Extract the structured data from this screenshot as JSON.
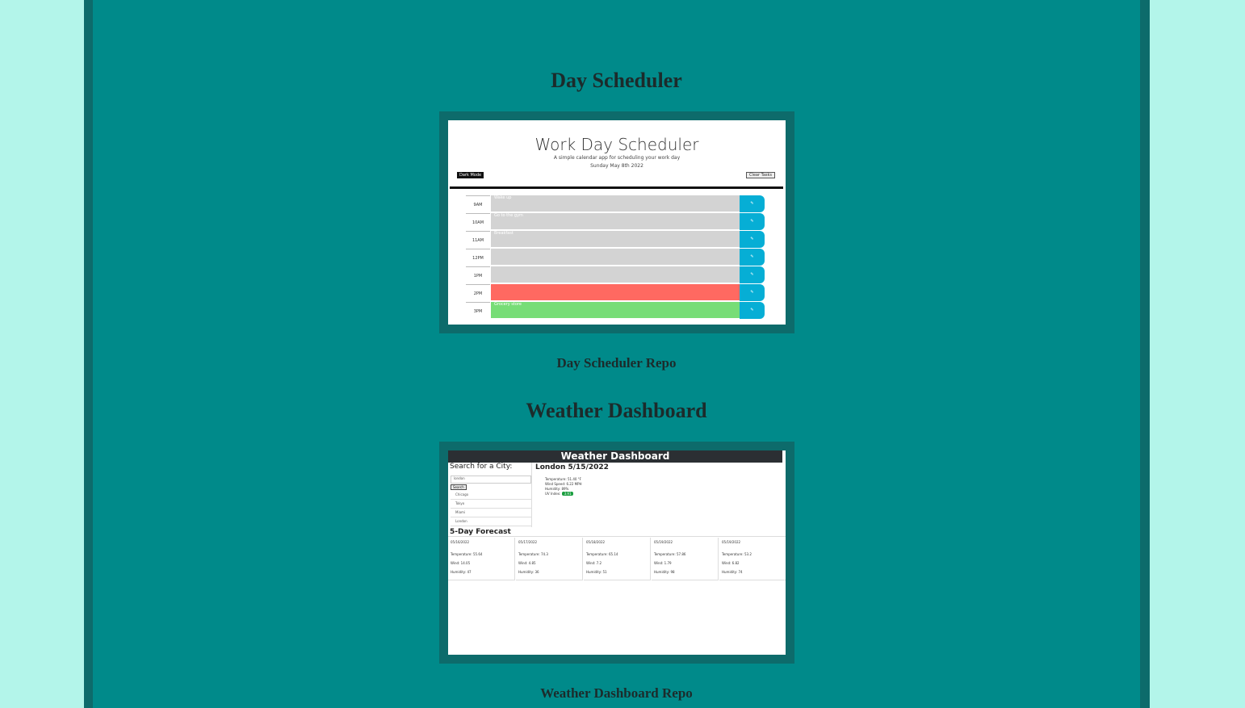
{
  "sections": [
    {
      "title": "Day Scheduler",
      "repo_label": "Day Scheduler Repo",
      "preview": {
        "app_title": "Work Day Scheduler",
        "subtitle": "A simple calendar app for scheduling your work day",
        "date": "Sunday May 8th 2022",
        "dark_mode_label": "Dark Mode",
        "clear_label": "Clear Tasks",
        "save_label": "✎",
        "rows": [
          {
            "hour": "9AM",
            "text": "Wake up",
            "color": "#d3d3d3"
          },
          {
            "hour": "10AM",
            "text": "Go to the gym",
            "color": "#d3d3d3"
          },
          {
            "hour": "11AM",
            "text": "Breakfast",
            "color": "#d3d3d3"
          },
          {
            "hour": "12PM",
            "text": "",
            "color": "#d3d3d3"
          },
          {
            "hour": "1PM",
            "text": "",
            "color": "#d3d3d3"
          },
          {
            "hour": "2PM",
            "text": "",
            "color": "#ff6961"
          },
          {
            "hour": "3PM",
            "text": "Grocery store",
            "color": "#77dd77"
          }
        ]
      }
    },
    {
      "title": "Weather Dashboard",
      "repo_label": "Weather Dashboard Repo",
      "preview": {
        "header": "Weather Dashboard",
        "search_label": "Search for a City:",
        "input_value": "london",
        "search_button": "Search",
        "cities": [
          "Chicago",
          "Tokyo",
          "Miami",
          "London"
        ],
        "current_title": "London 5/15/2022",
        "current": [
          "Temperature: 51.40 °F",
          "Wind Speed: 6.22 MPH",
          "Humidity: 89%"
        ],
        "uv_label": "UV Index:",
        "uv_value": "3.91",
        "forecast_title": "5-Day Forecast",
        "forecast": [
          {
            "date": "05/16/2022",
            "temp": "Temperature: 55.64",
            "wind": "Wind: 14.05",
            "humidity": "Humidity: 47"
          },
          {
            "date": "05/17/2022",
            "temp": "Temperature: 74.3",
            "wind": "Wind: 4.85",
            "humidity": "Humidity: 36"
          },
          {
            "date": "05/18/2022",
            "temp": "Temperature: 65.14",
            "wind": "Wind: 7.2",
            "humidity": "Humidity: 51"
          },
          {
            "date": "05/19/2022",
            "temp": "Temperature: 57.86",
            "wind": "Wind: 1.79",
            "humidity": "Humidity: 98"
          },
          {
            "date": "05/19/2022",
            "temp": "Temperature: 53.2",
            "wind": "Wind: 6.82",
            "humidity": "Humidity: 74"
          }
        ]
      }
    }
  ],
  "colors": {
    "page_bg": "#b3f5ea",
    "frame": "#0d6b6b",
    "content_bg": "#008a8a",
    "heading": "#1c2b2b",
    "save_button": "#06aed5"
  }
}
